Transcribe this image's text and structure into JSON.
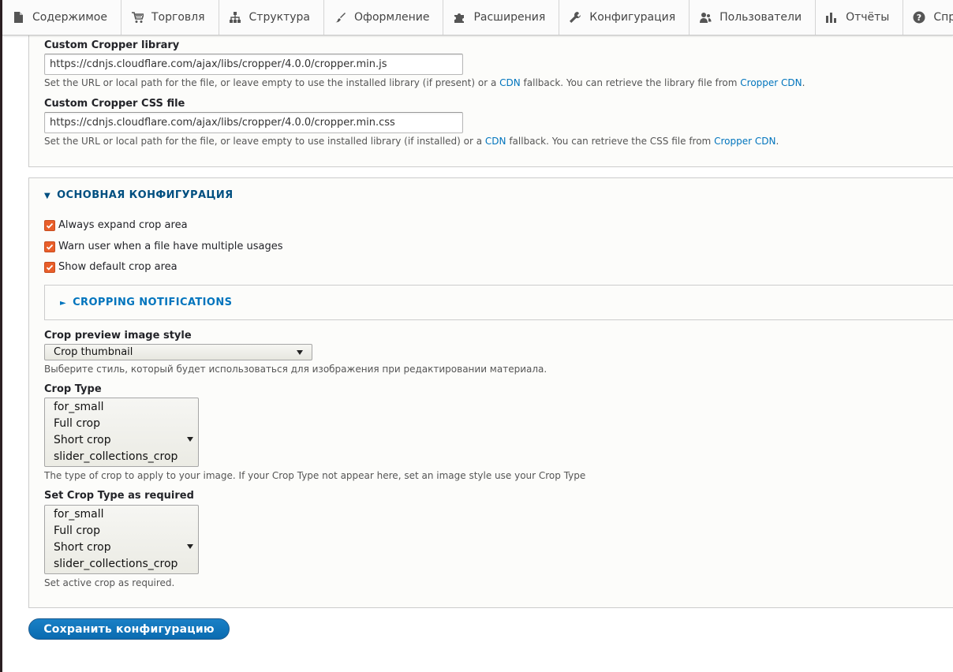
{
  "toolbar": {
    "items": [
      {
        "label": "Содержимое",
        "icon": "file-icon"
      },
      {
        "label": "Торговля",
        "icon": "cart-icon"
      },
      {
        "label": "Структура",
        "icon": "sitemap-icon"
      },
      {
        "label": "Оформление",
        "icon": "paintbrush-icon"
      },
      {
        "label": "Расширения",
        "icon": "puzzle-icon"
      },
      {
        "label": "Конфигурация",
        "icon": "wrench-icon"
      },
      {
        "label": "Пользователи",
        "icon": "users-icon"
      },
      {
        "label": "Отчёты",
        "icon": "bar-chart-icon"
      },
      {
        "label": "Справка",
        "icon": "help-icon"
      }
    ]
  },
  "library": {
    "cropper_library_label": "Custom Cropper library",
    "cropper_library_value": "https://cdnjs.cloudflare.com/ajax/libs/cropper/4.0.0/cropper.min.js",
    "cropper_library_desc_prefix": "Set the URL or local path for the file, or leave empty to use the installed library (if present) or a ",
    "cropper_library_desc_cdn": "CDN",
    "cropper_library_desc_mid": " fallback. You can retrieve the library file from ",
    "cropper_library_desc_link": "Cropper CDN",
    "cropper_library_desc_suffix": ".",
    "cropper_css_label": "Custom Cropper CSS file",
    "cropper_css_value": "https://cdnjs.cloudflare.com/ajax/libs/cropper/4.0.0/cropper.min.css",
    "cropper_css_desc_prefix": "Set the URL or local path for the file, or leave empty to use installed library (if installed) or a ",
    "cropper_css_desc_cdn": "CDN",
    "cropper_css_desc_mid": " fallback. You can retrieve the CSS file from ",
    "cropper_css_desc_link": "Cropper CDN",
    "cropper_css_desc_suffix": "."
  },
  "main": {
    "section_title": "Основная конфигурация",
    "section_marker": "▼",
    "checkboxes": [
      {
        "label": "Always expand crop area",
        "checked": true
      },
      {
        "label": "Warn user when a file have multiple usages",
        "checked": true
      },
      {
        "label": "Show default crop area",
        "checked": true
      }
    ],
    "notifications_title": "Cropping notifications",
    "notifications_marker": "►",
    "preview_label": "Crop preview image style",
    "preview_value": "Crop thumbnail",
    "preview_desc": "Выберите стиль, который будет использоваться для изображения при редактировании материала.",
    "crop_type_label": "Crop Type",
    "crop_type_options": [
      "for_small",
      "Full crop",
      "Short crop",
      "slider_collections_crop"
    ],
    "crop_type_desc": "The type of crop to apply to your image. If your Crop Type not appear here, set an image style use your Crop Type",
    "required_label": "Set Crop Type as required",
    "required_options": [
      "for_small",
      "Full crop",
      "Short crop",
      "slider_collections_crop"
    ],
    "required_desc": "Set active crop as required."
  },
  "actions": {
    "save_label": "Сохранить конфигурацию"
  },
  "colors": {
    "accent": "#0074bd",
    "section_title": "#004f80",
    "checkbox": "#e95e2a"
  }
}
